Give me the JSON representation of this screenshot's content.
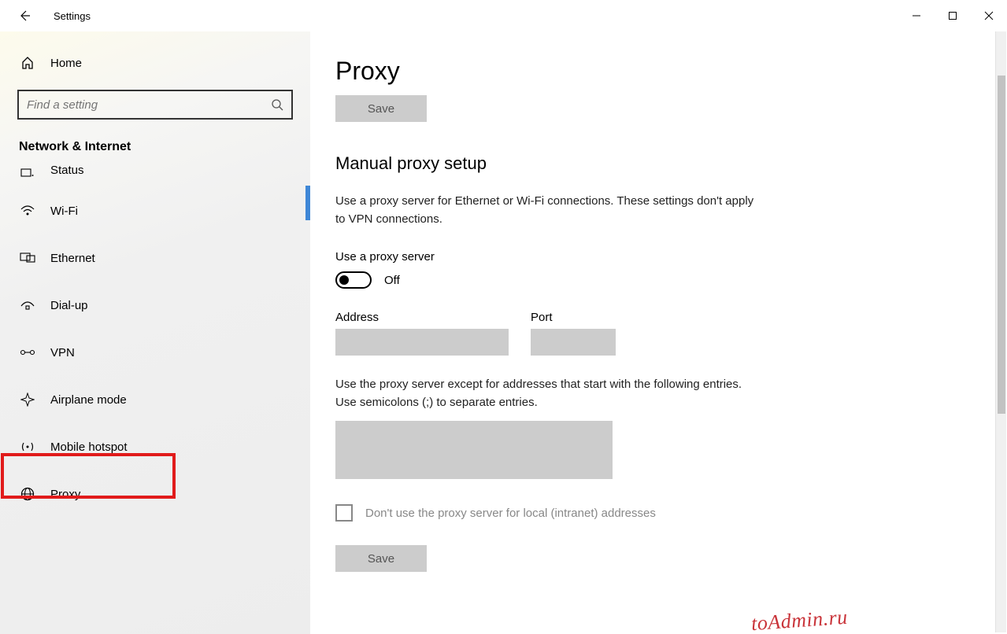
{
  "window": {
    "title": "Settings",
    "min": "−",
    "max": "▢",
    "close": "✕"
  },
  "sidebar": {
    "home_label": "Home",
    "search_placeholder": "Find a setting",
    "category": "Network & Internet",
    "items": [
      {
        "label": "Status",
        "icon": "status-icon"
      },
      {
        "label": "Wi-Fi",
        "icon": "wifi-icon"
      },
      {
        "label": "Ethernet",
        "icon": "ethernet-icon"
      },
      {
        "label": "Dial-up",
        "icon": "dialup-icon"
      },
      {
        "label": "VPN",
        "icon": "vpn-icon"
      },
      {
        "label": "Airplane mode",
        "icon": "airplane-icon"
      },
      {
        "label": "Mobile hotspot",
        "icon": "hotspot-icon"
      },
      {
        "label": "Proxy",
        "icon": "proxy-icon"
      }
    ]
  },
  "main": {
    "page_title": "Proxy",
    "save1": "Save",
    "section_title": "Manual proxy setup",
    "desc": "Use a proxy server for Ethernet or Wi-Fi connections. These settings don't apply to VPN connections.",
    "use_proxy_label": "Use a proxy server",
    "toggle_state": "Off",
    "address_label": "Address",
    "port_label": "Port",
    "except_text": "Use the proxy server except for addresses that start with the following entries. Use semicolons (;) to separate entries.",
    "checkbox_label": "Don't use the proxy server for local (intranet) addresses",
    "save2": "Save"
  },
  "watermark": "toAdmin.ru"
}
